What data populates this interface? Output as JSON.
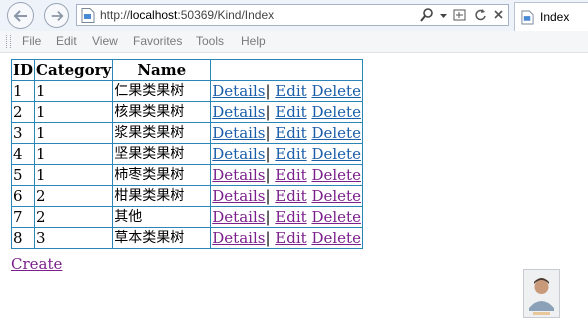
{
  "browser": {
    "url_prefix": "http://",
    "url_host": "localhost",
    "url_path": ":50369/Kind/Index",
    "tab_title": "Index",
    "menu": [
      "File",
      "Edit",
      "View",
      "Favorites",
      "Tools",
      "Help"
    ]
  },
  "table": {
    "headers": [
      "ID",
      "Category",
      "Name",
      ""
    ],
    "rows": [
      {
        "id": "1",
        "category": "1",
        "name": "仁果类果树",
        "visited": false
      },
      {
        "id": "2",
        "category": "1",
        "name": "核果类果树",
        "visited": false
      },
      {
        "id": "3",
        "category": "1",
        "name": "浆果类果树",
        "visited": false
      },
      {
        "id": "4",
        "category": "1",
        "name": "坚果类果树",
        "visited": false
      },
      {
        "id": "5",
        "category": "1",
        "name": "柿枣类果树",
        "visited": true
      },
      {
        "id": "6",
        "category": "2",
        "name": "柑果类果树",
        "visited": true
      },
      {
        "id": "7",
        "category": "2",
        "name": "其他",
        "visited": true
      },
      {
        "id": "8",
        "category": "3",
        "name": "草本类果树",
        "visited": true
      }
    ],
    "actions": {
      "details": "Details",
      "separator": "|",
      "edit": "Edit",
      "delete": "Delete"
    }
  },
  "create_link": "Create",
  "colors": {
    "link": "#1a5eaa",
    "visited_link": "#7b1f8c",
    "table_border": "#2b86b8"
  }
}
